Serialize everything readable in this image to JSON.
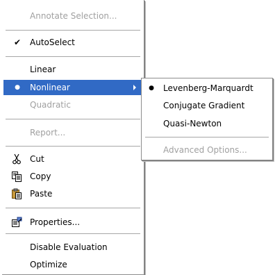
{
  "main_menu": {
    "annotate_selection": "Annotate Selection...",
    "autoselect": "AutoSelect",
    "linear": "Linear",
    "nonlinear": "Nonlinear",
    "quadratic": "Quadratic",
    "report": "Report...",
    "cut": "Cut",
    "copy": "Copy",
    "paste": "Paste",
    "properties": "Properties...",
    "disable_evaluation": "Disable Evaluation",
    "optimize": "Optimize",
    "checkmark": "✔",
    "bullet": "●"
  },
  "sub_menu": {
    "levenberg_marquardt": "Levenberg-Marquardt",
    "conjugate_gradient": "Conjugate Gradient",
    "quasi_newton": "Quasi-Newton",
    "advanced_options": "Advanced Options...",
    "bullet": "●"
  },
  "colors": {
    "highlight": "#316ac5",
    "disabled_text": "#a0a0a0"
  }
}
